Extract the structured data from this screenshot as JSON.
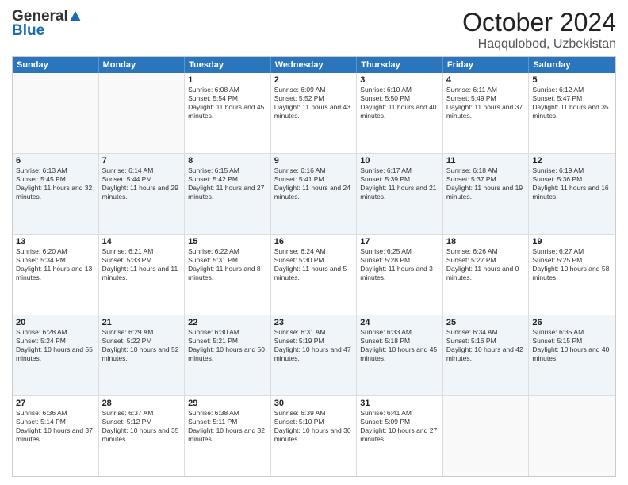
{
  "header": {
    "logo_general": "General",
    "logo_blue": "Blue",
    "month": "October 2024",
    "location": "Haqqulobod, Uzbekistan"
  },
  "days_of_week": [
    "Sunday",
    "Monday",
    "Tuesday",
    "Wednesday",
    "Thursday",
    "Friday",
    "Saturday"
  ],
  "weeks": [
    [
      {
        "day": "",
        "empty": true
      },
      {
        "day": "",
        "empty": true
      },
      {
        "day": "1",
        "sunrise": "Sunrise: 6:08 AM",
        "sunset": "Sunset: 5:54 PM",
        "daylight": "Daylight: 11 hours and 45 minutes."
      },
      {
        "day": "2",
        "sunrise": "Sunrise: 6:09 AM",
        "sunset": "Sunset: 5:52 PM",
        "daylight": "Daylight: 11 hours and 43 minutes."
      },
      {
        "day": "3",
        "sunrise": "Sunrise: 6:10 AM",
        "sunset": "Sunset: 5:50 PM",
        "daylight": "Daylight: 11 hours and 40 minutes."
      },
      {
        "day": "4",
        "sunrise": "Sunrise: 6:11 AM",
        "sunset": "Sunset: 5:49 PM",
        "daylight": "Daylight: 11 hours and 37 minutes."
      },
      {
        "day": "5",
        "sunrise": "Sunrise: 6:12 AM",
        "sunset": "Sunset: 5:47 PM",
        "daylight": "Daylight: 11 hours and 35 minutes."
      }
    ],
    [
      {
        "day": "6",
        "sunrise": "Sunrise: 6:13 AM",
        "sunset": "Sunset: 5:45 PM",
        "daylight": "Daylight: 11 hours and 32 minutes."
      },
      {
        "day": "7",
        "sunrise": "Sunrise: 6:14 AM",
        "sunset": "Sunset: 5:44 PM",
        "daylight": "Daylight: 11 hours and 29 minutes."
      },
      {
        "day": "8",
        "sunrise": "Sunrise: 6:15 AM",
        "sunset": "Sunset: 5:42 PM",
        "daylight": "Daylight: 11 hours and 27 minutes."
      },
      {
        "day": "9",
        "sunrise": "Sunrise: 6:16 AM",
        "sunset": "Sunset: 5:41 PM",
        "daylight": "Daylight: 11 hours and 24 minutes."
      },
      {
        "day": "10",
        "sunrise": "Sunrise: 6:17 AM",
        "sunset": "Sunset: 5:39 PM",
        "daylight": "Daylight: 11 hours and 21 minutes."
      },
      {
        "day": "11",
        "sunrise": "Sunrise: 6:18 AM",
        "sunset": "Sunset: 5:37 PM",
        "daylight": "Daylight: 11 hours and 19 minutes."
      },
      {
        "day": "12",
        "sunrise": "Sunrise: 6:19 AM",
        "sunset": "Sunset: 5:36 PM",
        "daylight": "Daylight: 11 hours and 16 minutes."
      }
    ],
    [
      {
        "day": "13",
        "sunrise": "Sunrise: 6:20 AM",
        "sunset": "Sunset: 5:34 PM",
        "daylight": "Daylight: 11 hours and 13 minutes."
      },
      {
        "day": "14",
        "sunrise": "Sunrise: 6:21 AM",
        "sunset": "Sunset: 5:33 PM",
        "daylight": "Daylight: 11 hours and 11 minutes."
      },
      {
        "day": "15",
        "sunrise": "Sunrise: 6:22 AM",
        "sunset": "Sunset: 5:31 PM",
        "daylight": "Daylight: 11 hours and 8 minutes."
      },
      {
        "day": "16",
        "sunrise": "Sunrise: 6:24 AM",
        "sunset": "Sunset: 5:30 PM",
        "daylight": "Daylight: 11 hours and 5 minutes."
      },
      {
        "day": "17",
        "sunrise": "Sunrise: 6:25 AM",
        "sunset": "Sunset: 5:28 PM",
        "daylight": "Daylight: 11 hours and 3 minutes."
      },
      {
        "day": "18",
        "sunrise": "Sunrise: 6:26 AM",
        "sunset": "Sunset: 5:27 PM",
        "daylight": "Daylight: 11 hours and 0 minutes."
      },
      {
        "day": "19",
        "sunrise": "Sunrise: 6:27 AM",
        "sunset": "Sunset: 5:25 PM",
        "daylight": "Daylight: 10 hours and 58 minutes."
      }
    ],
    [
      {
        "day": "20",
        "sunrise": "Sunrise: 6:28 AM",
        "sunset": "Sunset: 5:24 PM",
        "daylight": "Daylight: 10 hours and 55 minutes."
      },
      {
        "day": "21",
        "sunrise": "Sunrise: 6:29 AM",
        "sunset": "Sunset: 5:22 PM",
        "daylight": "Daylight: 10 hours and 52 minutes."
      },
      {
        "day": "22",
        "sunrise": "Sunrise: 6:30 AM",
        "sunset": "Sunset: 5:21 PM",
        "daylight": "Daylight: 10 hours and 50 minutes."
      },
      {
        "day": "23",
        "sunrise": "Sunrise: 6:31 AM",
        "sunset": "Sunset: 5:19 PM",
        "daylight": "Daylight: 10 hours and 47 minutes."
      },
      {
        "day": "24",
        "sunrise": "Sunrise: 6:33 AM",
        "sunset": "Sunset: 5:18 PM",
        "daylight": "Daylight: 10 hours and 45 minutes."
      },
      {
        "day": "25",
        "sunrise": "Sunrise: 6:34 AM",
        "sunset": "Sunset: 5:16 PM",
        "daylight": "Daylight: 10 hours and 42 minutes."
      },
      {
        "day": "26",
        "sunrise": "Sunrise: 6:35 AM",
        "sunset": "Sunset: 5:15 PM",
        "daylight": "Daylight: 10 hours and 40 minutes."
      }
    ],
    [
      {
        "day": "27",
        "sunrise": "Sunrise: 6:36 AM",
        "sunset": "Sunset: 5:14 PM",
        "daylight": "Daylight: 10 hours and 37 minutes."
      },
      {
        "day": "28",
        "sunrise": "Sunrise: 6:37 AM",
        "sunset": "Sunset: 5:12 PM",
        "daylight": "Daylight: 10 hours and 35 minutes."
      },
      {
        "day": "29",
        "sunrise": "Sunrise: 6:38 AM",
        "sunset": "Sunset: 5:11 PM",
        "daylight": "Daylight: 10 hours and 32 minutes."
      },
      {
        "day": "30",
        "sunrise": "Sunrise: 6:39 AM",
        "sunset": "Sunset: 5:10 PM",
        "daylight": "Daylight: 10 hours and 30 minutes."
      },
      {
        "day": "31",
        "sunrise": "Sunrise: 6:41 AM",
        "sunset": "Sunset: 5:09 PM",
        "daylight": "Daylight: 10 hours and 27 minutes."
      },
      {
        "day": "",
        "empty": true
      },
      {
        "day": "",
        "empty": true
      }
    ]
  ]
}
